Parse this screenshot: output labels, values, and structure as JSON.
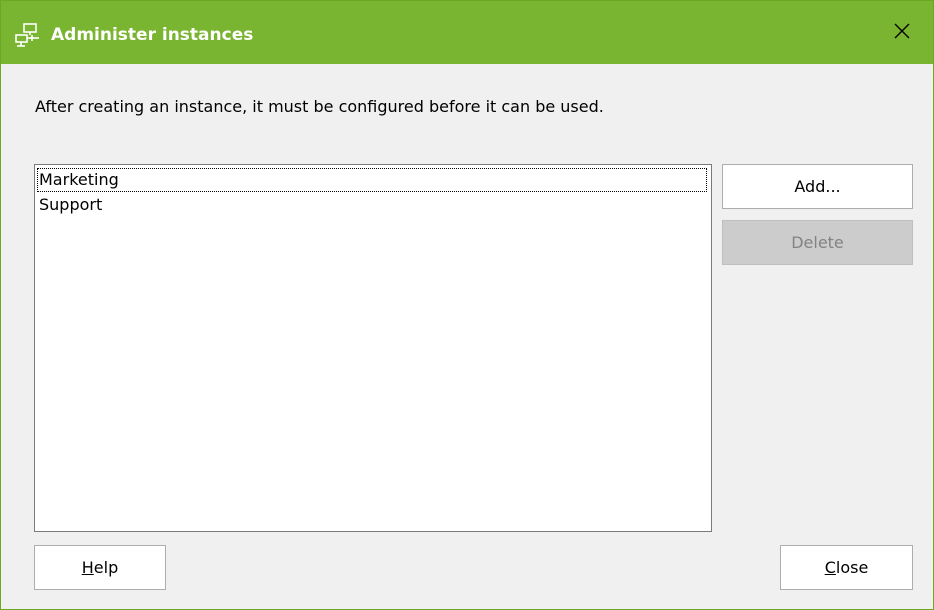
{
  "window": {
    "title": "Administer instances",
    "close_glyph": "✕"
  },
  "instructions": "After creating an instance, it must be configured before it can be used.",
  "instances": [
    {
      "label": "Marketing",
      "focused": true
    },
    {
      "label": "Support",
      "focused": false
    }
  ],
  "buttons": {
    "add": "Add...",
    "delete": "Delete",
    "help_mnemonic": "H",
    "help_rest": "elp",
    "close_mnemonic": "C",
    "close_rest": "lose"
  },
  "colors": {
    "titlebar": "#7ab532",
    "dialog_bg": "#f0f0f0",
    "disabled_button": "#cccccc"
  },
  "icons": {
    "title_icon": "network-computers-icon"
  }
}
